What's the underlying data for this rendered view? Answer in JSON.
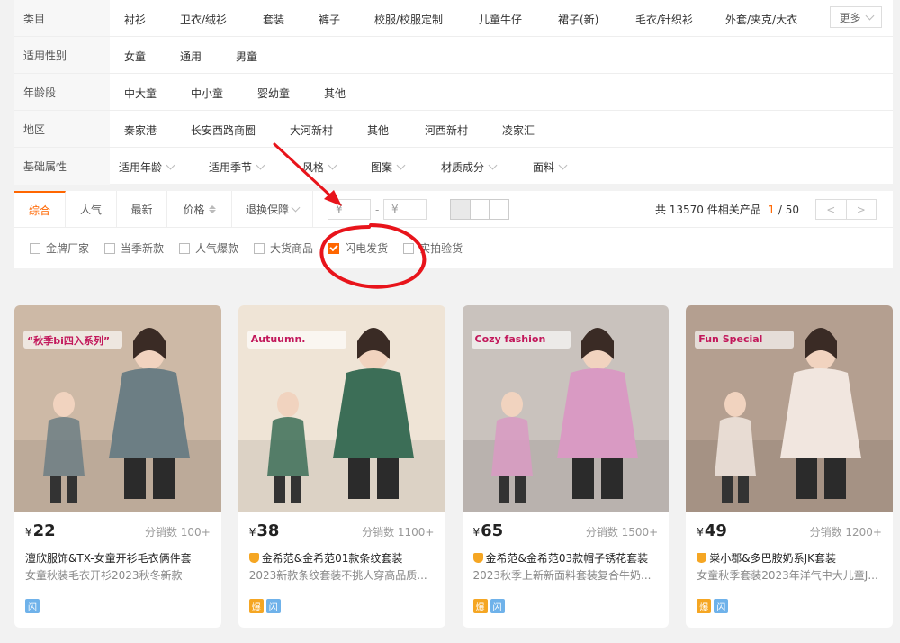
{
  "filters": {
    "rows": [
      {
        "label": "类目",
        "options": [
          "衬衫",
          "卫衣/绒衫",
          "套装",
          "裤子",
          "校服/校服定制",
          "儿童牛仔",
          "裙子(新)",
          "毛衣/针织衫",
          "外套/夹克/大衣"
        ],
        "more": "更多"
      },
      {
        "label": "适用性别",
        "options": [
          "女童",
          "通用",
          "男童"
        ]
      },
      {
        "label": "年龄段",
        "options": [
          "中大童",
          "中小童",
          "婴幼童",
          "其他"
        ]
      },
      {
        "label": "地区",
        "options": [
          "秦家港",
          "长安西路商圈",
          "大河新村",
          "其他",
          "河西新村",
          "凌家汇"
        ]
      },
      {
        "label": "基础属性",
        "options": [
          "适用年龄",
          "适用季节",
          "风格",
          "图案",
          "材质成分",
          "面料"
        ]
      }
    ]
  },
  "sortbar": {
    "tabs": [
      "综合",
      "人气",
      "最新",
      "价格",
      "退换保障"
    ],
    "price_min_placeholder": "¥",
    "price_max_placeholder": "¥",
    "price_dash": "-",
    "total_prefix": "共 13570 件相关产品",
    "page_current": "1",
    "page_total": "/ 50",
    "prev": "<",
    "next": ">"
  },
  "checks": [
    {
      "label": "金牌厂家",
      "checked": false
    },
    {
      "label": "当季新款",
      "checked": false
    },
    {
      "label": "人气爆款",
      "checked": false
    },
    {
      "label": "大货商品",
      "checked": false
    },
    {
      "label": "闪电发货",
      "checked": true
    },
    {
      "label": "实拍验货",
      "checked": false
    }
  ],
  "products": [
    {
      "price": "22",
      "sales": "分销数 100+",
      "title": "澶欣服饰&TX-女童开衫毛衣俩件套",
      "subtitle": "女童秋装毛衣开衫2023秋冬新款",
      "shield": false,
      "badges": [
        "闪"
      ],
      "bg": "#cdb9a6",
      "accent": "#6c7e84",
      "banner": "“秋季bi四入系列”"
    },
    {
      "price": "38",
      "sales": "分销数 1100+",
      "title": "金希范&金希范01款条纹套装",
      "subtitle": "2023新款条纹套装不挑人穿高品质...",
      "shield": true,
      "badges": [
        "爆",
        "闪"
      ],
      "bg": "#efe4d6",
      "accent": "#3c6e57",
      "banner": "Autuumn."
    },
    {
      "price": "65",
      "sales": "分销数 1500+",
      "title": "金希范&金希范03款帽子锈花套装",
      "subtitle": "2023秋季上新新面料套装复合牛奶...",
      "shield": true,
      "badges": [
        "爆",
        "闪"
      ],
      "bg": "#c9c2bd",
      "accent": "#d99ac3",
      "banner": "Cozy fashion"
    },
    {
      "price": "49",
      "sales": "分销数 1200+",
      "title": "粜小郡&多巴胺奶系JK套装",
      "subtitle": "女童秋季套装2023年洋气中大儿童J...",
      "shield": true,
      "badges": [
        "爆",
        "闪"
      ],
      "bg": "#b49f90",
      "accent": "#f1e6df",
      "banner": "Fun Special"
    }
  ],
  "currency": "¥",
  "colors": {
    "accent": "#ff6600",
    "annotation": "#e8141b"
  }
}
